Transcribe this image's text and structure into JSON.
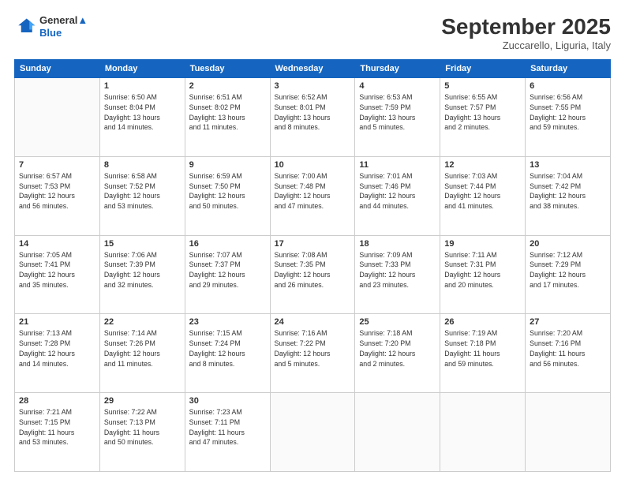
{
  "logo": {
    "line1": "General",
    "line2": "Blue"
  },
  "title": "September 2025",
  "location": "Zuccarello, Liguria, Italy",
  "weekdays": [
    "Sunday",
    "Monday",
    "Tuesday",
    "Wednesday",
    "Thursday",
    "Friday",
    "Saturday"
  ],
  "weeks": [
    [
      {
        "day": "",
        "info": ""
      },
      {
        "day": "1",
        "info": "Sunrise: 6:50 AM\nSunset: 8:04 PM\nDaylight: 13 hours\nand 14 minutes."
      },
      {
        "day": "2",
        "info": "Sunrise: 6:51 AM\nSunset: 8:02 PM\nDaylight: 13 hours\nand 11 minutes."
      },
      {
        "day": "3",
        "info": "Sunrise: 6:52 AM\nSunset: 8:01 PM\nDaylight: 13 hours\nand 8 minutes."
      },
      {
        "day": "4",
        "info": "Sunrise: 6:53 AM\nSunset: 7:59 PM\nDaylight: 13 hours\nand 5 minutes."
      },
      {
        "day": "5",
        "info": "Sunrise: 6:55 AM\nSunset: 7:57 PM\nDaylight: 13 hours\nand 2 minutes."
      },
      {
        "day": "6",
        "info": "Sunrise: 6:56 AM\nSunset: 7:55 PM\nDaylight: 12 hours\nand 59 minutes."
      }
    ],
    [
      {
        "day": "7",
        "info": "Sunrise: 6:57 AM\nSunset: 7:53 PM\nDaylight: 12 hours\nand 56 minutes."
      },
      {
        "day": "8",
        "info": "Sunrise: 6:58 AM\nSunset: 7:52 PM\nDaylight: 12 hours\nand 53 minutes."
      },
      {
        "day": "9",
        "info": "Sunrise: 6:59 AM\nSunset: 7:50 PM\nDaylight: 12 hours\nand 50 minutes."
      },
      {
        "day": "10",
        "info": "Sunrise: 7:00 AM\nSunset: 7:48 PM\nDaylight: 12 hours\nand 47 minutes."
      },
      {
        "day": "11",
        "info": "Sunrise: 7:01 AM\nSunset: 7:46 PM\nDaylight: 12 hours\nand 44 minutes."
      },
      {
        "day": "12",
        "info": "Sunrise: 7:03 AM\nSunset: 7:44 PM\nDaylight: 12 hours\nand 41 minutes."
      },
      {
        "day": "13",
        "info": "Sunrise: 7:04 AM\nSunset: 7:42 PM\nDaylight: 12 hours\nand 38 minutes."
      }
    ],
    [
      {
        "day": "14",
        "info": "Sunrise: 7:05 AM\nSunset: 7:41 PM\nDaylight: 12 hours\nand 35 minutes."
      },
      {
        "day": "15",
        "info": "Sunrise: 7:06 AM\nSunset: 7:39 PM\nDaylight: 12 hours\nand 32 minutes."
      },
      {
        "day": "16",
        "info": "Sunrise: 7:07 AM\nSunset: 7:37 PM\nDaylight: 12 hours\nand 29 minutes."
      },
      {
        "day": "17",
        "info": "Sunrise: 7:08 AM\nSunset: 7:35 PM\nDaylight: 12 hours\nand 26 minutes."
      },
      {
        "day": "18",
        "info": "Sunrise: 7:09 AM\nSunset: 7:33 PM\nDaylight: 12 hours\nand 23 minutes."
      },
      {
        "day": "19",
        "info": "Sunrise: 7:11 AM\nSunset: 7:31 PM\nDaylight: 12 hours\nand 20 minutes."
      },
      {
        "day": "20",
        "info": "Sunrise: 7:12 AM\nSunset: 7:29 PM\nDaylight: 12 hours\nand 17 minutes."
      }
    ],
    [
      {
        "day": "21",
        "info": "Sunrise: 7:13 AM\nSunset: 7:28 PM\nDaylight: 12 hours\nand 14 minutes."
      },
      {
        "day": "22",
        "info": "Sunrise: 7:14 AM\nSunset: 7:26 PM\nDaylight: 12 hours\nand 11 minutes."
      },
      {
        "day": "23",
        "info": "Sunrise: 7:15 AM\nSunset: 7:24 PM\nDaylight: 12 hours\nand 8 minutes."
      },
      {
        "day": "24",
        "info": "Sunrise: 7:16 AM\nSunset: 7:22 PM\nDaylight: 12 hours\nand 5 minutes."
      },
      {
        "day": "25",
        "info": "Sunrise: 7:18 AM\nSunset: 7:20 PM\nDaylight: 12 hours\nand 2 minutes."
      },
      {
        "day": "26",
        "info": "Sunrise: 7:19 AM\nSunset: 7:18 PM\nDaylight: 11 hours\nand 59 minutes."
      },
      {
        "day": "27",
        "info": "Sunrise: 7:20 AM\nSunset: 7:16 PM\nDaylight: 11 hours\nand 56 minutes."
      }
    ],
    [
      {
        "day": "28",
        "info": "Sunrise: 7:21 AM\nSunset: 7:15 PM\nDaylight: 11 hours\nand 53 minutes."
      },
      {
        "day": "29",
        "info": "Sunrise: 7:22 AM\nSunset: 7:13 PM\nDaylight: 11 hours\nand 50 minutes."
      },
      {
        "day": "30",
        "info": "Sunrise: 7:23 AM\nSunset: 7:11 PM\nDaylight: 11 hours\nand 47 minutes."
      },
      {
        "day": "",
        "info": ""
      },
      {
        "day": "",
        "info": ""
      },
      {
        "day": "",
        "info": ""
      },
      {
        "day": "",
        "info": ""
      }
    ]
  ]
}
